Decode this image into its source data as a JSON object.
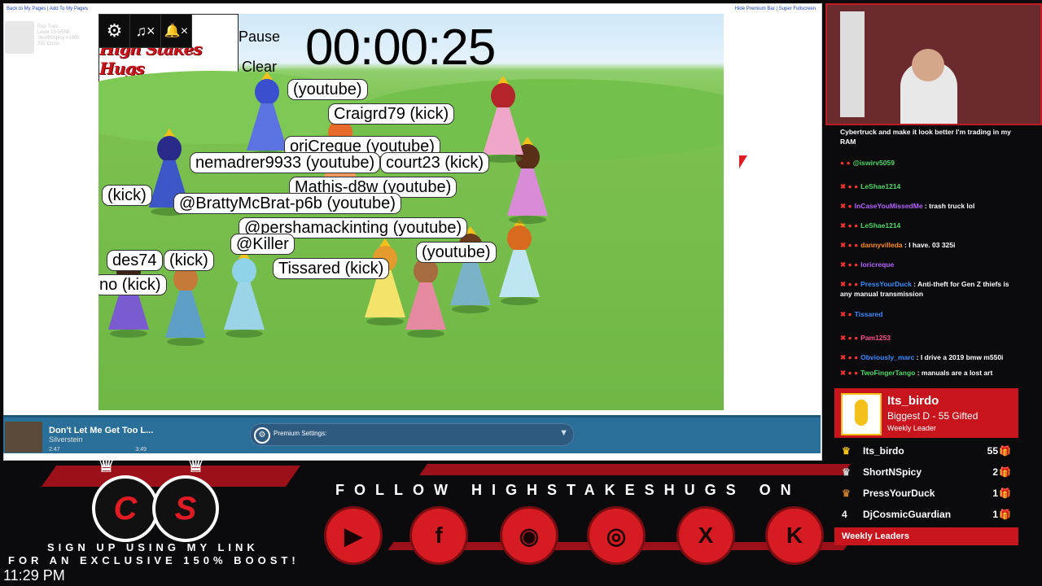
{
  "browser": {
    "top_links": "Back to My Pages | Add To My Pages",
    "top_right_links": "Hide Premium Bar | Super Fullscreen",
    "pet_card": [
      "Pop Train",
      "Level 10 0/550",
      "ShortNSpicy #1900",
      "232 Coins"
    ]
  },
  "game": {
    "controls": {
      "settings": "⚙",
      "music_mute": "♫×",
      "bell_mute": "🔔×"
    },
    "pause_label": "Pause",
    "clear_label": "Clear",
    "timer": "00:00:25",
    "logo_text": "High Stakes Hugs",
    "name_tags": [
      "(youtube)",
      "Craigrd79 (kick)",
      "oriCreque (youtube)",
      "nemadrer9933 (youtube)",
      "court23 (kick)",
      "Mathis-d8w (youtube)",
      "(kick)",
      "@BrattyMcBrat-p6b (youtube)",
      "@pershamackinting (youtube)",
      "@Killer",
      "(youtube)",
      "Tissared (kick)",
      "no (kick)",
      "des74",
      "(kick)"
    ]
  },
  "player": {
    "song_title": "Don't Let Me Get Too L...",
    "artist": "Silverstein",
    "time_elapsed": "2:47",
    "time_total": "3:49",
    "premium_label": "Premium Settings:"
  },
  "chat": {
    "top_message": "Cybertruck and make it look better I'm trading in my RAM",
    "messages": [
      {
        "user": "@iswirv5059",
        "text": ""
      },
      {
        "user": "LeShae1214",
        "text": ""
      },
      {
        "user": "InCaseYouMissedMe",
        "text": "trash truck lol"
      },
      {
        "user": "LeShae1214",
        "text": ""
      },
      {
        "user": "dannyvilleda",
        "text": "I have. 03 325i"
      },
      {
        "user": "loricreque",
        "text": ""
      },
      {
        "user": "PressYourDuck",
        "text": "Anti-theft for Gen Z thiefs is any manual transmission"
      },
      {
        "user": "Tissared",
        "text": ""
      },
      {
        "user": "Pam1253",
        "text": ""
      },
      {
        "user": "Obviously_marc",
        "text": "I drive a 2019 bmw m550i"
      },
      {
        "user": "TwoFingerTango",
        "text": "manuals are a lost art"
      }
    ]
  },
  "leaderboard": {
    "top_name": "Its_birdo",
    "top_sub": "Biggest D - 55 Gifted",
    "top_tag": "Weekly Leader",
    "rows": [
      {
        "rank": "",
        "name": "Its_birdo",
        "count": "55"
      },
      {
        "rank": "",
        "name": "ShortNSpicy",
        "count": "2"
      },
      {
        "rank": "",
        "name": "PressYourDuck",
        "count": "1"
      },
      {
        "rank": "4",
        "name": "DjCosmicGuardian",
        "count": "1"
      }
    ],
    "footer": "Weekly Leaders"
  },
  "overlay": {
    "follow_text": "FOLLOW HIGHSTAKESHUGS ON",
    "socials": [
      "youtube-icon",
      "facebook-icon",
      "discord-icon",
      "instagram-icon",
      "x-icon",
      "kick-icon"
    ],
    "social_glyphs": [
      "▶",
      "f",
      "◉",
      "◎",
      "X",
      "K"
    ],
    "cs_letters": [
      "C",
      "S"
    ],
    "signup_line1": "SIGN UP USING MY LINK",
    "signup_line2": "FOR AN EXCLUSIVE 150% BOOST!",
    "clock": "11:29 PM"
  },
  "colors": {
    "accent": "#c8141c",
    "chat_user": "#4cd964",
    "player_bar": "#2a6f99"
  }
}
